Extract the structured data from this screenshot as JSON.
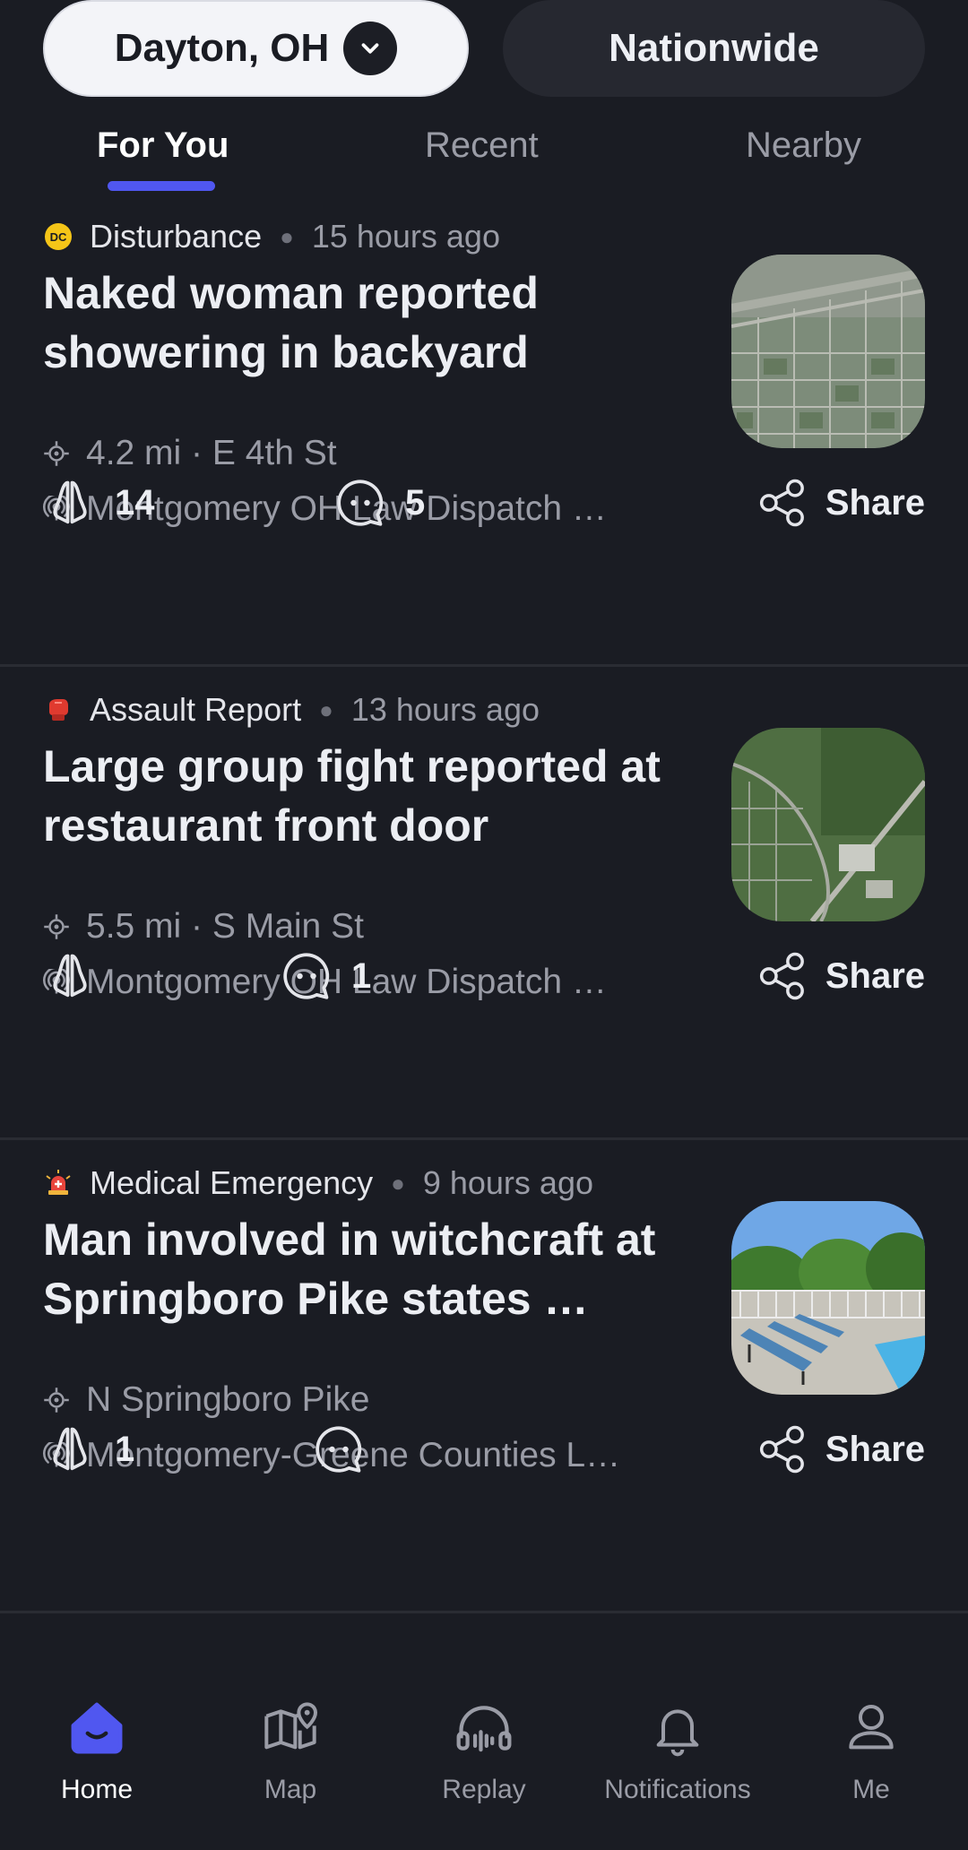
{
  "scope": {
    "location": "Dayton, OH",
    "nationwide": "Nationwide"
  },
  "tabs": [
    {
      "label": "For You"
    },
    {
      "label": "Recent"
    },
    {
      "label": "Nearby"
    }
  ],
  "feed": [
    {
      "category": "Disturbance",
      "category_icon": "dc-badge-icon",
      "time": "15 hours ago",
      "title": "Naked woman reported showering in backyard",
      "location": "4.2 mi · E 4th St",
      "source": "Montgomery OH Law Dispatch …",
      "thumbnail": "aerial-map-thumbnail",
      "likes": "14",
      "comments": "5",
      "share": "Share"
    },
    {
      "category": "Assault Report",
      "category_icon": "boxing-glove-icon",
      "time": "13 hours ago",
      "title": "Large group fight reported at restaurant front door",
      "location": "5.5 mi · S Main St",
      "source": "Montgomery OH Law Dispatch …",
      "thumbnail": "aerial-map-thumbnail",
      "likes": "",
      "comments": "1",
      "share": "Share"
    },
    {
      "category": "Medical Emergency",
      "category_icon": "siren-icon",
      "time": "9 hours ago",
      "title": "Man involved in witchcraft at Springboro Pike states …",
      "location": "N Springboro Pike",
      "source": "Montgomery-Greene Counties L…",
      "thumbnail": "pool-deck-photo",
      "likes": "1",
      "comments": "",
      "share": "Share"
    }
  ],
  "bottom_nav": [
    {
      "label": "Home",
      "icon": "home-icon"
    },
    {
      "label": "Map",
      "icon": "map-icon"
    },
    {
      "label": "Replay",
      "icon": "headphones-icon"
    },
    {
      "label": "Notifications",
      "icon": "bell-icon"
    },
    {
      "label": "Me",
      "icon": "person-icon"
    }
  ],
  "colors": {
    "background": "#1a1c23",
    "accent": "#5057f0",
    "pill_active": "#f3f4f8",
    "pill_inactive": "#262830"
  }
}
